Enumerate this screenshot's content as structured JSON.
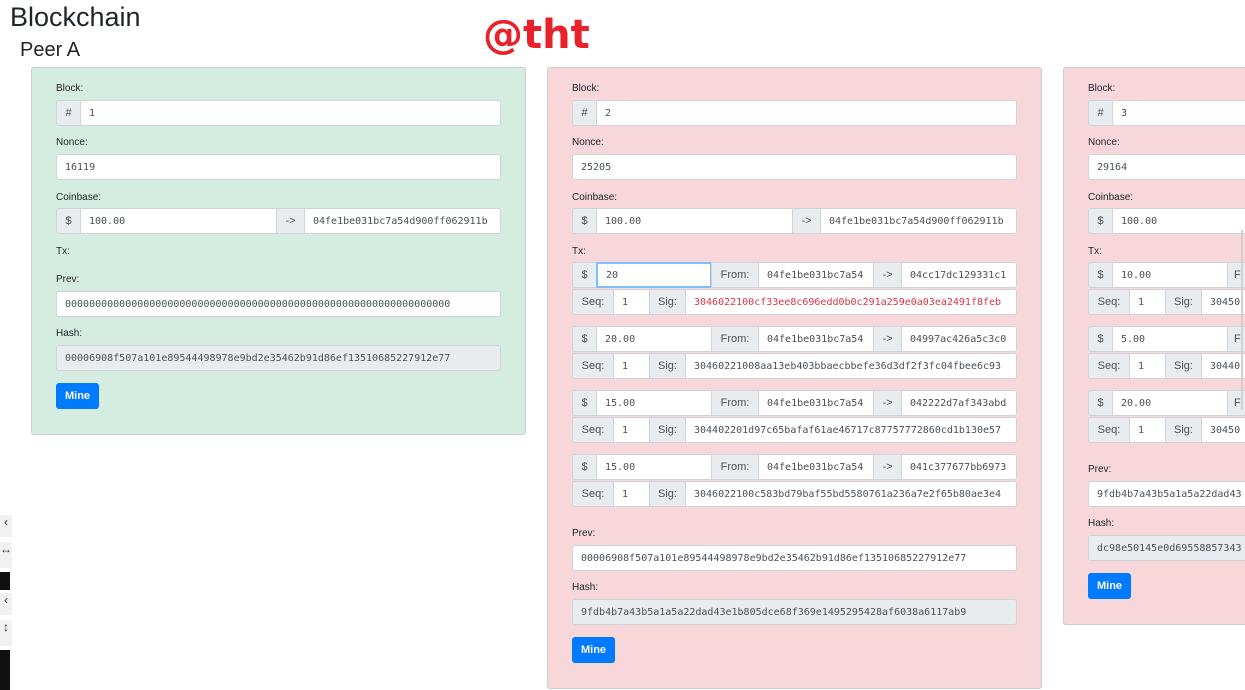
{
  "header": {
    "title": "Blockchain",
    "peer": "Peer A",
    "watermark": "@tht"
  },
  "labels": {
    "block": "Block:",
    "nonce": "Nonce:",
    "coinbase": "Coinbase:",
    "tx": "Tx:",
    "prev": "Prev:",
    "hash": "Hash:",
    "hash_sign": "#",
    "dollar": "$",
    "arrow": "->",
    "from": "From:",
    "seq": "Seq:",
    "sig": "Sig:",
    "mine": "Mine"
  },
  "blocks": [
    {
      "number": "1",
      "nonce": "16119",
      "coinbase": {
        "amount": "100.00",
        "to": "04fe1be031bc7a54d900ff062911b"
      },
      "txs": [],
      "prev": "0000000000000000000000000000000000000000000000000000000000000000",
      "hash": "00006908f507a101e89544498978e9bd2e35462b91d86ef13510685227912e77"
    },
    {
      "number": "2",
      "nonce": "25205",
      "coinbase": {
        "amount": "100.00",
        "to": "04fe1be031bc7a54d900ff062911b"
      },
      "txs": [
        {
          "amount": "20",
          "from": "04fe1be031bc7a54",
          "to": "04cc17dc129331c1",
          "seq": "1",
          "sig": "3046022100cf33ee8c696edd0b0c291a259e0a03ea2491f8feb"
        },
        {
          "amount": "20.00",
          "from": "04fe1be031bc7a54",
          "to": "04997ac426a5c3c0",
          "seq": "1",
          "sig": "30460221008aa13eb403bbaecbbefe36d3df2f3fc04fbee6c93"
        },
        {
          "amount": "15.00",
          "from": "04fe1be031bc7a54",
          "to": "042222d7af343abd",
          "seq": "1",
          "sig": "304402201d97c65bafaf61ae46717c87757772860cd1b130e57"
        },
        {
          "amount": "15.00",
          "from": "04fe1be031bc7a54",
          "to": "041c377677bb6973",
          "seq": "1",
          "sig": "3046022100c583bd79baf55bd5580761a236a7e2f65b80ae3e4"
        }
      ],
      "prev": "00006908f507a101e89544498978e9bd2e35462b91d86ef13510685227912e77",
      "hash": "9fdb4b7a43b5a1a5a22dad43e1b805dce68f369e1495295428af6038a6117ab9"
    },
    {
      "number": "3",
      "nonce": "29164",
      "coinbase": {
        "amount": "100.00",
        "to": ""
      },
      "txs": [
        {
          "amount": "10.00",
          "seq": "1",
          "sig": "30450"
        },
        {
          "amount": "5.00",
          "seq": "1",
          "sig": "30440"
        },
        {
          "amount": "20.00",
          "seq": "1",
          "sig": "30450"
        }
      ],
      "prev": "9fdb4b7a43b5a1a5a22dad43",
      "hash": "dc98e50145e0d69558857343"
    }
  ],
  "colors": {
    "valid_bg": "#d5ede0",
    "invalid_bg": "#f7d7da",
    "primary": "#007bff",
    "watermark": "#e8212b"
  }
}
